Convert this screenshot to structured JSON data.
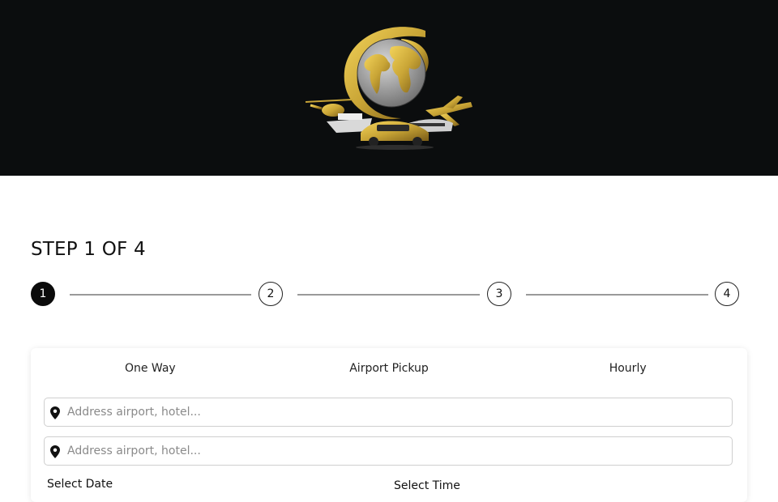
{
  "header": {
    "logo_icon": "globe-travel-logo-icon",
    "background_color": "#0b0d0e",
    "accent_color": "#c9a536"
  },
  "wizard": {
    "title": "STEP 1 OF 4",
    "steps": [
      {
        "label": "1",
        "active": true
      },
      {
        "label": "2",
        "active": false
      },
      {
        "label": "3",
        "active": false
      },
      {
        "label": "4",
        "active": false
      }
    ]
  },
  "booking": {
    "tabs": [
      {
        "label": "One Way"
      },
      {
        "label": "Airport Pickup"
      },
      {
        "label": "Hourly"
      }
    ],
    "pickup": {
      "placeholder": "Address airport, hotel...",
      "value": "",
      "icon": "location-pin-icon"
    },
    "dropoff": {
      "placeholder": "Address airport, hotel...",
      "value": "",
      "icon": "location-pin-icon"
    },
    "date_label": "Select Date",
    "time_label": "Select Time"
  }
}
